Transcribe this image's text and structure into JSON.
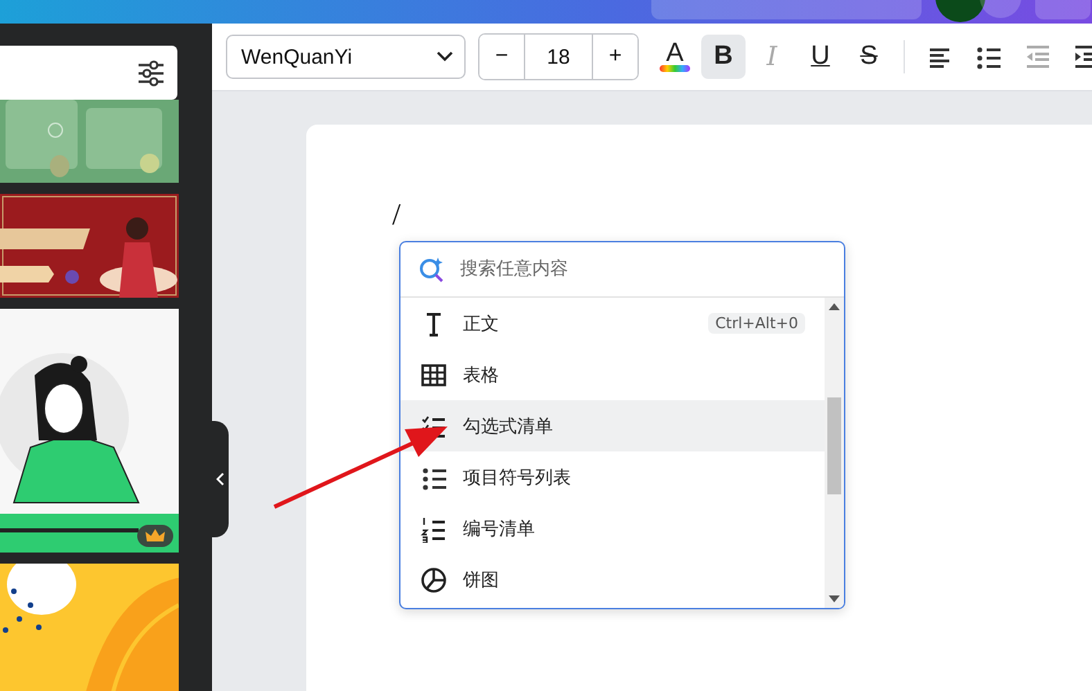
{
  "toolbar": {
    "font": {
      "value": "WenQuanYi"
    },
    "size": {
      "decrease": "−",
      "value": "18",
      "increase": "+"
    },
    "tools": [
      {
        "kind": "text-color",
        "glyph": "A",
        "selected": false,
        "disabled": false
      },
      {
        "kind": "bold",
        "glyph": "B",
        "selected": true,
        "disabled": false
      },
      {
        "kind": "italic",
        "glyph": "I",
        "selected": false,
        "disabled": true
      },
      {
        "kind": "underline",
        "glyph": "U",
        "selected": false,
        "disabled": false
      },
      {
        "kind": "strike",
        "glyph": "S",
        "selected": false,
        "disabled": false
      },
      {
        "kind": "divider"
      },
      {
        "kind": "align-left",
        "selected": false,
        "disabled": false
      },
      {
        "kind": "bullets",
        "selected": false,
        "disabled": false
      },
      {
        "kind": "outdent",
        "selected": false,
        "disabled": true
      },
      {
        "kind": "indent",
        "selected": false,
        "disabled": false
      }
    ]
  },
  "sidebar": {
    "thumbnails": [
      {
        "kind": "picture",
        "premium": false
      },
      {
        "kind": "picture",
        "premium": false
      },
      {
        "kind": "picture",
        "premium": true
      },
      {
        "kind": "picture",
        "premium": false
      }
    ]
  },
  "document": {
    "text": "/"
  },
  "command_menu": {
    "search": {
      "placeholder": "搜索任意内容"
    },
    "items": [
      {
        "kind": "text",
        "label": "正文",
        "shortcut": "Ctrl+Alt+0",
        "selected": false
      },
      {
        "kind": "table",
        "label": "表格",
        "selected": false
      },
      {
        "kind": "checklist",
        "label": "勾选式清单",
        "selected": true
      },
      {
        "kind": "bullets",
        "label": "项目符号列表",
        "selected": false
      },
      {
        "kind": "numbered",
        "label": "编号清单",
        "selected": false
      },
      {
        "kind": "pie",
        "label": "饼图",
        "selected": false
      }
    ]
  }
}
